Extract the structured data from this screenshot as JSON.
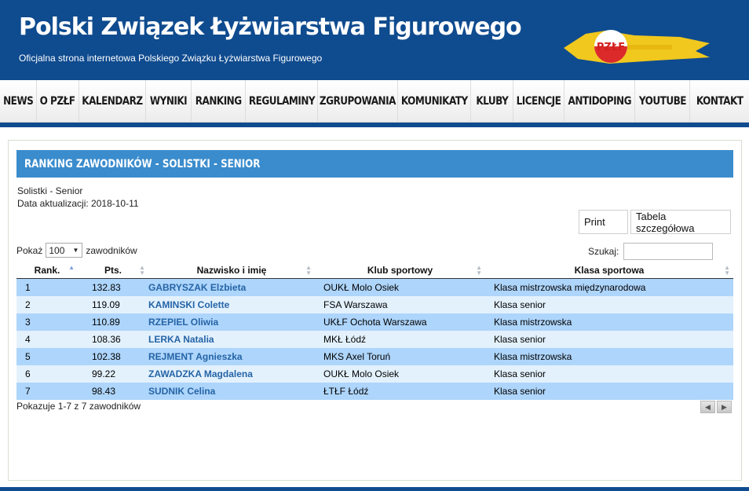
{
  "site": {
    "title": "Polski Związek Łyżwiarstwa Figurowego",
    "subtitle": "Oficjalna strona internetowa Polskiego Związku Łyżwiarstwa Figurowego",
    "logo_text": "PZŁF"
  },
  "nav": {
    "items": [
      "NEWS",
      "O PZŁF",
      "KALENDARZ",
      "WYNIKI",
      "RANKING",
      "REGULAMINY",
      "ZGRUPOWANIA",
      "KOMUNIKATY",
      "KLUBY",
      "LICENCJE",
      "ANTIDOPING",
      "YOUTUBE",
      "KONTAKT"
    ]
  },
  "section": {
    "title": "RANKING ZAWODNIKÓW - SOLISTKI - SENIOR",
    "category": "Solistki - Senior",
    "updated": "Data aktualizacji: 2018-10-11"
  },
  "buttons": {
    "print": "Print",
    "detail_table": "Tabela szczegółowa"
  },
  "controls": {
    "show_prefix": "Pokaż",
    "show_value": "100",
    "show_suffix": "zawodników",
    "search_label": "Szukaj:",
    "search_value": ""
  },
  "table": {
    "columns": [
      "Rank.",
      "Pts.",
      "Nazwisko i imię",
      "Klub sportowy",
      "Klasa sportowa"
    ],
    "rows": [
      {
        "rank": "1",
        "pts": "132.83",
        "name": "GABRYSZAK Elzbieta",
        "club": "OUKŁ Molo Osiek",
        "class": "Klasa mistrzowska międzynarodowa"
      },
      {
        "rank": "2",
        "pts": "119.09",
        "name": "KAMINSKI Colette",
        "club": "FSA Warszawa",
        "class": "Klasa senior"
      },
      {
        "rank": "3",
        "pts": "110.89",
        "name": "RZEPIEL Oliwia",
        "club": "UKŁF Ochota Warszawa",
        "class": "Klasa mistrzowska"
      },
      {
        "rank": "4",
        "pts": "108.36",
        "name": "LERKA Natalia",
        "club": "MKŁ Łódź",
        "class": "Klasa senior"
      },
      {
        "rank": "5",
        "pts": "102.38",
        "name": "REJMENT Agnieszka",
        "club": "MKS Axel Toruń",
        "class": "Klasa mistrzowska"
      },
      {
        "rank": "6",
        "pts": "99.22",
        "name": "ZAWADZKA Magdalena",
        "club": "OUKŁ Molo Osiek",
        "class": "Klasa senior"
      },
      {
        "rank": "7",
        "pts": "98.43",
        "name": "SUDNIK Celina",
        "club": "ŁTŁF Łódź",
        "class": "Klasa senior"
      }
    ],
    "info": "Pokazuje 1-7 z 7 zawodników"
  },
  "colors": {
    "header_bg": "#0f4b8f",
    "section_header": "#3a8ccd",
    "row_odd": "#aed5fb",
    "row_even": "#e3f1fd",
    "name_link": "#2464a6"
  }
}
